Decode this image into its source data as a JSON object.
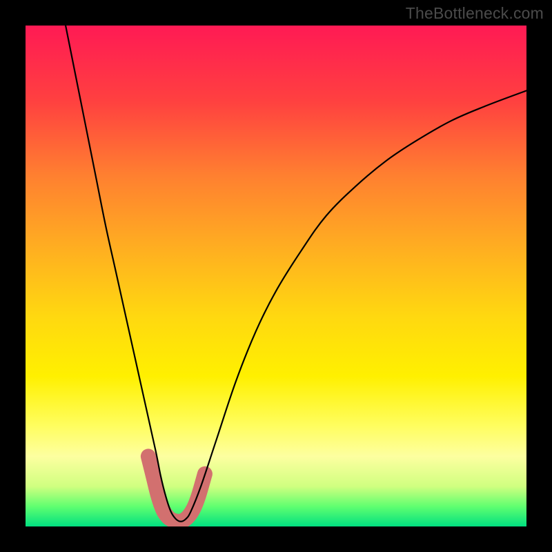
{
  "watermark": "TheBottleneck.com",
  "chart_data": {
    "type": "line",
    "title": "",
    "xlabel": "",
    "ylabel": "",
    "xlim": [
      0,
      100
    ],
    "ylim": [
      0,
      100
    ],
    "grid": false,
    "legend": false,
    "gradient_colors": {
      "top": "#ff1a54",
      "mid": "#fff000",
      "bottom": "#00e080"
    },
    "series": [
      {
        "name": "primary-curve",
        "color": "#000000",
        "stroke_width": 2,
        "x": [
          8,
          10,
          12,
          14,
          16,
          18,
          20,
          22,
          24,
          26,
          27,
          28,
          29,
          30,
          31,
          32,
          33,
          35,
          38,
          42,
          46,
          50,
          55,
          60,
          66,
          72,
          78,
          85,
          92,
          100
        ],
        "y": [
          100,
          90,
          80,
          70,
          60,
          51,
          42,
          33,
          24,
          15,
          10,
          6,
          3,
          1.5,
          1,
          1.5,
          3,
          8,
          17,
          29,
          39,
          47,
          55,
          62,
          68,
          73,
          77,
          81,
          84,
          87
        ]
      },
      {
        "name": "valley-highlight",
        "color": "#d2706f",
        "stroke_width": 20,
        "x": [
          24.5,
          25.5,
          26.5,
          27.5,
          28.5,
          29.5,
          30.5,
          31.5,
          32.5,
          33.5,
          34.5,
          35.8
        ],
        "y": [
          14,
          10,
          6,
          3.2,
          1.8,
          1.2,
          1.0,
          1.2,
          2.0,
          3.5,
          6.0,
          10.5
        ]
      }
    ]
  }
}
